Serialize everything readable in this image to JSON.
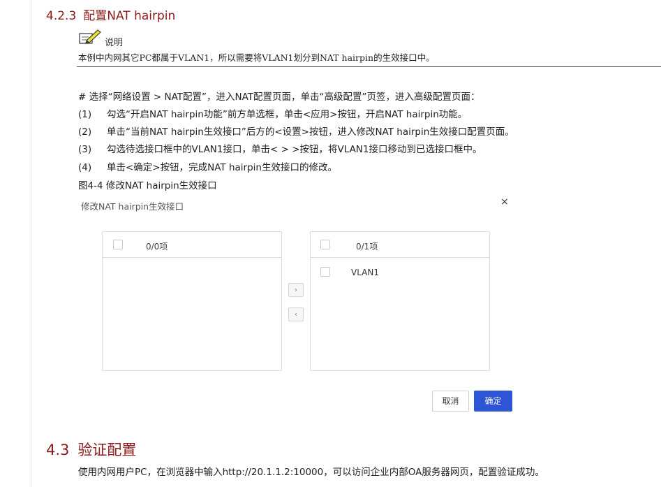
{
  "section": {
    "number": "4.2.3",
    "title": "配置NAT hairpin"
  },
  "note": {
    "label": "说明",
    "text": "本例中内网其它PC都属于VLAN1，所以需要将VLAN1划分到NAT hairpin的生效接口中。"
  },
  "steps": {
    "intro": "# 选择“网络设置 > NAT配置”，进入NAT配置页面，单击“高级配置”页签，进入高级配置页面：",
    "items": [
      {
        "num": "(1)",
        "text": "勾选“开启NAT hairpin功能”前方单选框，单击<应用>按钮，开启NAT hairpin功能。"
      },
      {
        "num": "(2)",
        "text": "单击“当前NAT hairpin生效接口”后方的<设置>按钮，进入修改NAT hairpin生效接口配置页面。"
      },
      {
        "num": "(3)",
        "text": "勾选待选接口框中的VLAN1接口，单击< > >按钮，将VLAN1接口移动到已选接口框中。"
      },
      {
        "num": "(4)",
        "text": "单击<确定>按钮，完成NAT hairpin生效接口的修改。"
      }
    ]
  },
  "figure_caption": "图4-4 修改NAT hairpin生效接口",
  "dialog": {
    "title": "修改NAT hairpin生效接口",
    "close": "×",
    "left_panel": {
      "count": "0/0项",
      "items": []
    },
    "right_panel": {
      "count": "0/1项",
      "items": [
        "VLAN1"
      ]
    },
    "move_right": "›",
    "move_left": "‹",
    "cancel": "取消",
    "ok": "确定"
  },
  "section2": {
    "number": "4.3",
    "title": "验证配置",
    "text": "使用内网用户PC，在浏览器中输入http://20.1.1.2:10000，可以访问企业内部OA服务器网页，配置验证成功。"
  },
  "colors": {
    "heading": "#8b1a1a",
    "primary_button": "#2d55d6"
  }
}
